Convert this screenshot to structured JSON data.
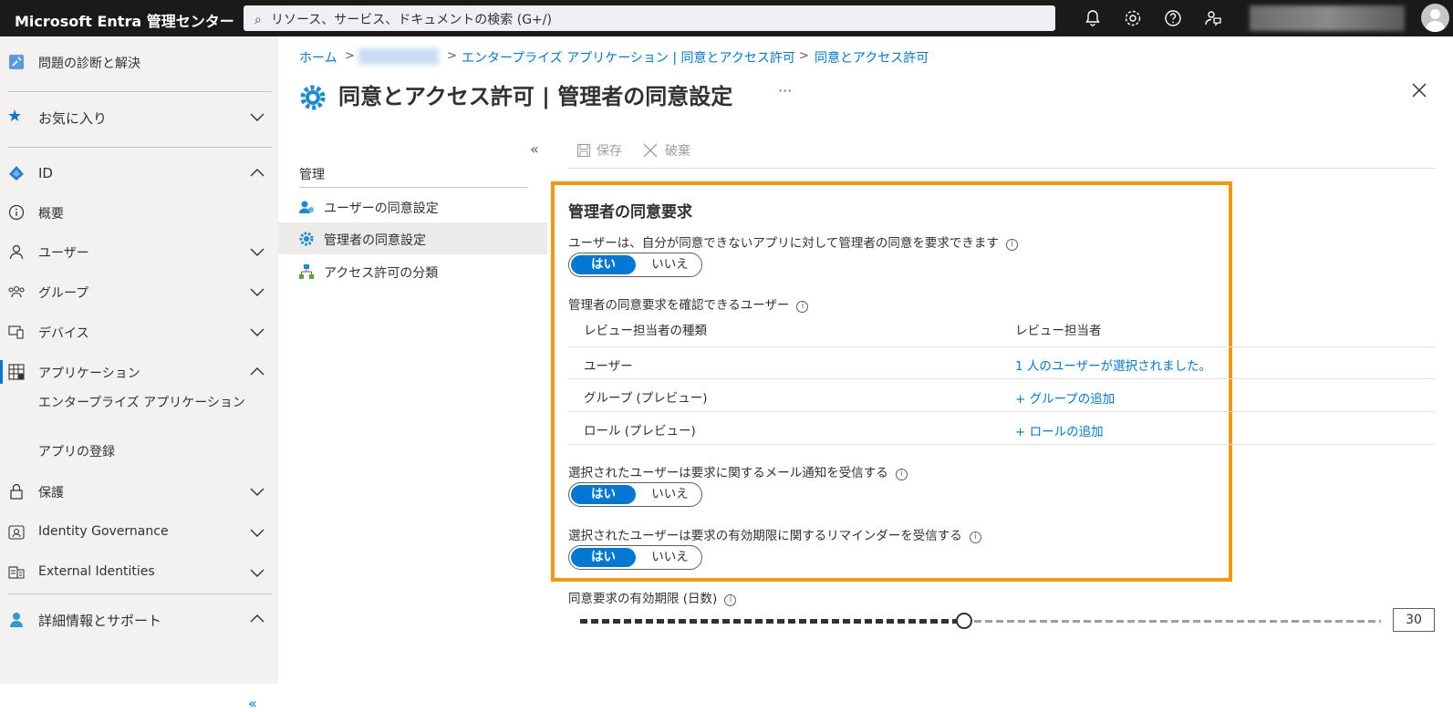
{
  "topbar": {
    "brand": "Microsoft Entra 管理センター",
    "search_placeholder": "リソース、サービス、ドキュメントの検索 (G+/)"
  },
  "sidebar": {
    "diagnose": "問題の診断と解決",
    "favorites": "お気に入り",
    "id": "ID",
    "overview": "概要",
    "users": "ユーザー",
    "groups": "グループ",
    "devices": "デバイス",
    "applications": "アプリケーション",
    "enterprise_apps": "エンタープライズ アプリケーション",
    "app_registrations": "アプリの登録",
    "protection": "保護",
    "identity_governance": "Identity Governance",
    "external_identities": "External Identities",
    "learn_support": "詳細情報とサポート",
    "collapse": "«"
  },
  "breadcrumb": {
    "home": "ホーム",
    "enterprise": "エンタープライズ アプリケーション | 同意とアクセス許可",
    "current": "同意とアクセス許可"
  },
  "page": {
    "title": "同意とアクセス許可 | 管理者の同意設定",
    "more": "···"
  },
  "manage": {
    "collapse": "«",
    "header": "管理",
    "items": [
      "ユーザーの同意設定",
      "管理者の同意設定",
      "アクセス許可の分類"
    ]
  },
  "commands": {
    "save": "保存",
    "discard": "破棄"
  },
  "admin_consent": {
    "section_title": "管理者の同意要求",
    "q1": "ユーザーは、自分が同意できないアプリに対して管理者の同意を要求できます",
    "q2": "管理者の同意要求を確認できるユーザー",
    "q3": "選択されたユーザーは要求に関するメール通知を受信する",
    "q4": "選択されたユーザーは要求の有効期限に関するリマインダーを受信する",
    "yes": "はい",
    "no": "いいえ",
    "col_type": "レビュー担当者の種類",
    "col_reviewer": "レビュー担当者",
    "rows": [
      {
        "type": "ユーザー",
        "reviewer": "1 人のユーザーが選択されました。"
      },
      {
        "type": "グループ (プレビュー)",
        "reviewer": "+ グループの追加"
      },
      {
        "type": "ロール (プレビュー)",
        "reviewer": "+ ロールの追加"
      }
    ]
  },
  "expiry": {
    "label": "同意要求の有効期限 (日数)",
    "value": "30",
    "slider_fraction": 0.48
  },
  "colors": {
    "accent": "#0078d4",
    "highlight": "#f7960b"
  }
}
